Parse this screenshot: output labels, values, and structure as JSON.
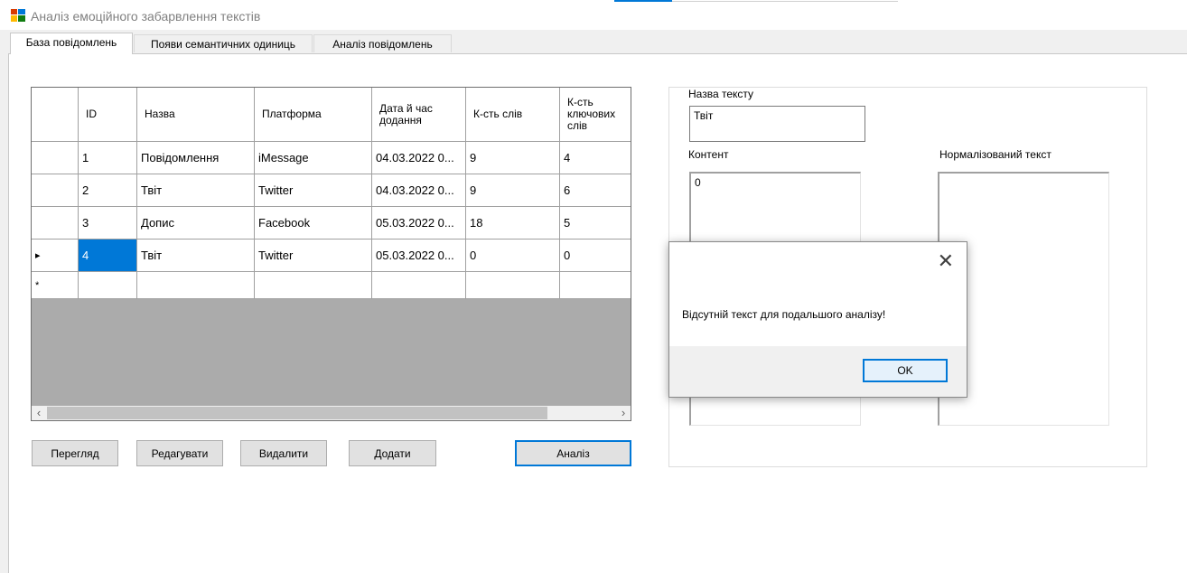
{
  "window": {
    "title": "Аналіз емоційного забарвлення текстів"
  },
  "tabs": [
    {
      "label": "База повідомлень",
      "active": true
    },
    {
      "label": "Появи семантичних одиниць",
      "active": false
    },
    {
      "label": "Аналіз повідомлень",
      "active": false
    }
  ],
  "grid": {
    "columns": [
      "ID",
      "Назва",
      "Платформа",
      "Дата й час додання",
      "К-сть слів",
      "К-сть ключових слів"
    ],
    "rows": [
      {
        "marker": "",
        "cells": [
          "1",
          "Повідомлення",
          "iMessage",
          "04.03.2022 0...",
          "9",
          "4"
        ]
      },
      {
        "marker": "",
        "cells": [
          "2",
          "Твіт",
          "Twitter",
          "04.03.2022 0...",
          "9",
          "6"
        ]
      },
      {
        "marker": "",
        "cells": [
          "3",
          "Допис",
          "Facebook",
          "05.03.2022 0...",
          "18",
          "5"
        ]
      },
      {
        "marker": "▸",
        "cells": [
          "4",
          "Твіт",
          "Twitter",
          "05.03.2022 0...",
          "0",
          "0"
        ]
      }
    ],
    "new_row_marker": "*",
    "scroll_left": "‹",
    "scroll_right": "›"
  },
  "buttons": {
    "view": "Перегляд",
    "edit": "Редагувати",
    "delete": "Видалити",
    "add": "Додати",
    "analyze": "Аналіз"
  },
  "details": {
    "name_label": "Назва тексту",
    "name_value": "Твіт",
    "content_label": "Контент",
    "content_value": "0",
    "normalized_label": "Нормалізований текст",
    "normalized_value": ""
  },
  "dialog": {
    "message": "Відсутній текст для подальшого аналізу!",
    "ok_label": "OK",
    "close_glyph": "✕"
  },
  "colors": {
    "accent": "#0078d7",
    "selection": "#0078d7",
    "grid_empty": "#ababab"
  }
}
